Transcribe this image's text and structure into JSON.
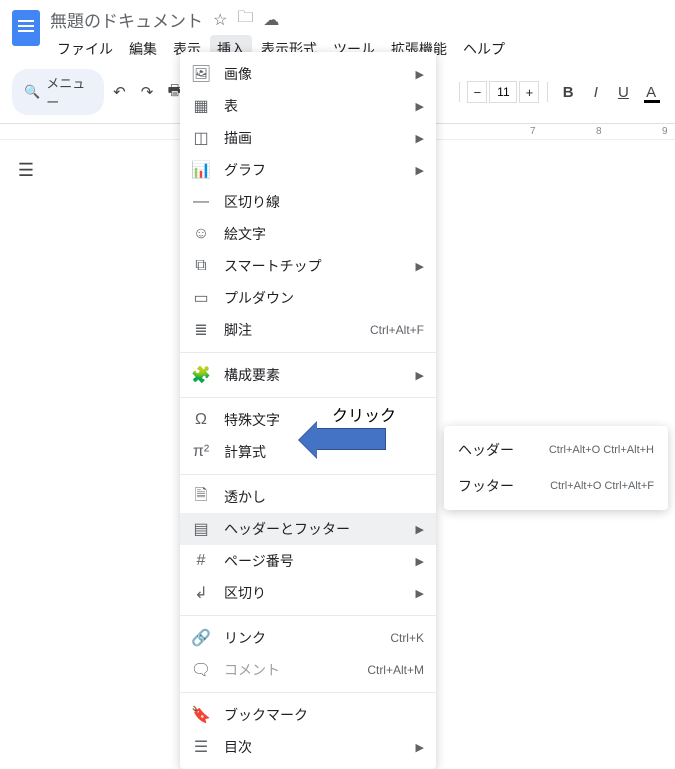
{
  "title": "無題のドキュメント",
  "menubar": [
    "ファイル",
    "編集",
    "表示",
    "挿入",
    "表示形式",
    "ツール",
    "拡張機能",
    "ヘルプ"
  ],
  "active_menu_index": 3,
  "toolbar": {
    "menu_label": "メニュー",
    "font_size": "11"
  },
  "insert_menu": {
    "groups": [
      [
        {
          "icon": "🖼",
          "label": "画像",
          "submenu": true
        },
        {
          "icon": "▦",
          "label": "表",
          "submenu": true
        },
        {
          "icon": "◫",
          "label": "描画",
          "submenu": true
        },
        {
          "icon": "📊",
          "label": "グラフ",
          "submenu": true
        },
        {
          "icon": "—",
          "label": "区切り線"
        },
        {
          "icon": "☺",
          "label": "絵文字"
        },
        {
          "icon": "⧉",
          "label": "スマートチップ",
          "submenu": true
        },
        {
          "icon": "▭",
          "label": "プルダウン"
        },
        {
          "icon": "≣",
          "label": "脚注",
          "shortcut": "Ctrl+Alt+F"
        }
      ],
      [
        {
          "icon": "🧩",
          "label": "構成要素",
          "submenu": true
        }
      ],
      [
        {
          "icon": "Ω",
          "label": "特殊文字"
        },
        {
          "icon": "π²",
          "label": "計算式"
        }
      ],
      [
        {
          "icon": "🗎",
          "label": "透かし"
        },
        {
          "icon": "▤",
          "label": "ヘッダーとフッター",
          "submenu": true,
          "highlight": true
        },
        {
          "icon": "#",
          "label": "ページ番号",
          "submenu": true
        },
        {
          "icon": "↲",
          "label": "区切り",
          "submenu": true
        }
      ],
      [
        {
          "icon": "🔗",
          "label": "リンク",
          "shortcut": "Ctrl+K"
        },
        {
          "icon": "🗨",
          "label": "コメント",
          "shortcut": "Ctrl+Alt+M",
          "disabled": true
        }
      ],
      [
        {
          "icon": "🔖",
          "label": "ブックマーク"
        },
        {
          "icon": "☰",
          "label": "目次",
          "submenu": true
        }
      ]
    ]
  },
  "submenu": [
    {
      "label": "ヘッダー",
      "shortcut": "Ctrl+Alt+O Ctrl+Alt+H"
    },
    {
      "label": "フッター",
      "shortcut": "Ctrl+Alt+O Ctrl+Alt+F"
    }
  ],
  "annotation": {
    "arrow_label": "クリック"
  },
  "ruler_ticks": [
    "7",
    "8",
    "9"
  ]
}
